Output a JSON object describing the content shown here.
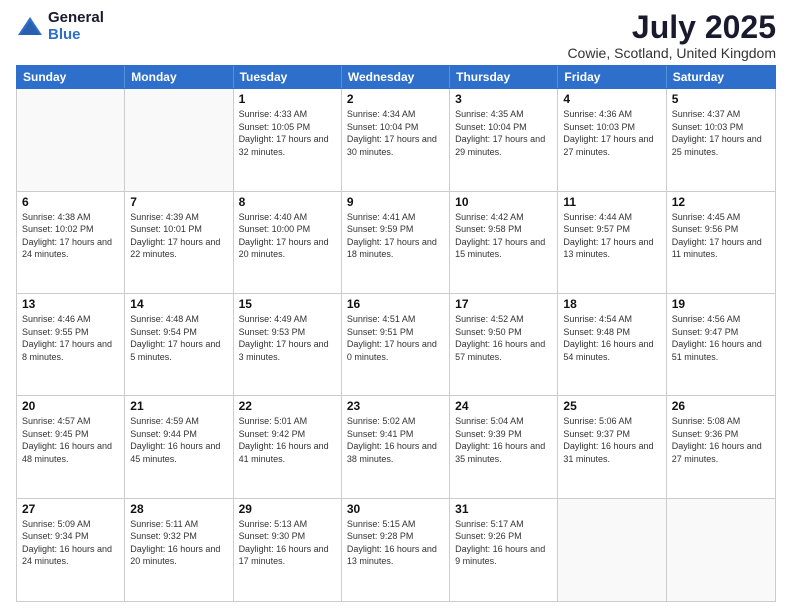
{
  "logo": {
    "general": "General",
    "blue": "Blue"
  },
  "title": "July 2025",
  "subtitle": "Cowie, Scotland, United Kingdom",
  "days_of_week": [
    "Sunday",
    "Monday",
    "Tuesday",
    "Wednesday",
    "Thursday",
    "Friday",
    "Saturday"
  ],
  "weeks": [
    [
      {
        "day": "",
        "empty": true
      },
      {
        "day": "",
        "empty": true
      },
      {
        "day": "1",
        "sunrise": "4:33 AM",
        "sunset": "10:05 PM",
        "daylight": "17 hours and 32 minutes."
      },
      {
        "day": "2",
        "sunrise": "4:34 AM",
        "sunset": "10:04 PM",
        "daylight": "17 hours and 30 minutes."
      },
      {
        "day": "3",
        "sunrise": "4:35 AM",
        "sunset": "10:04 PM",
        "daylight": "17 hours and 29 minutes."
      },
      {
        "day": "4",
        "sunrise": "4:36 AM",
        "sunset": "10:03 PM",
        "daylight": "17 hours and 27 minutes."
      },
      {
        "day": "5",
        "sunrise": "4:37 AM",
        "sunset": "10:03 PM",
        "daylight": "17 hours and 25 minutes."
      }
    ],
    [
      {
        "day": "6",
        "sunrise": "4:38 AM",
        "sunset": "10:02 PM",
        "daylight": "17 hours and 24 minutes."
      },
      {
        "day": "7",
        "sunrise": "4:39 AM",
        "sunset": "10:01 PM",
        "daylight": "17 hours and 22 minutes."
      },
      {
        "day": "8",
        "sunrise": "4:40 AM",
        "sunset": "10:00 PM",
        "daylight": "17 hours and 20 minutes."
      },
      {
        "day": "9",
        "sunrise": "4:41 AM",
        "sunset": "9:59 PM",
        "daylight": "17 hours and 18 minutes."
      },
      {
        "day": "10",
        "sunrise": "4:42 AM",
        "sunset": "9:58 PM",
        "daylight": "17 hours and 15 minutes."
      },
      {
        "day": "11",
        "sunrise": "4:44 AM",
        "sunset": "9:57 PM",
        "daylight": "17 hours and 13 minutes."
      },
      {
        "day": "12",
        "sunrise": "4:45 AM",
        "sunset": "9:56 PM",
        "daylight": "17 hours and 11 minutes."
      }
    ],
    [
      {
        "day": "13",
        "sunrise": "4:46 AM",
        "sunset": "9:55 PM",
        "daylight": "17 hours and 8 minutes."
      },
      {
        "day": "14",
        "sunrise": "4:48 AM",
        "sunset": "9:54 PM",
        "daylight": "17 hours and 5 minutes."
      },
      {
        "day": "15",
        "sunrise": "4:49 AM",
        "sunset": "9:53 PM",
        "daylight": "17 hours and 3 minutes."
      },
      {
        "day": "16",
        "sunrise": "4:51 AM",
        "sunset": "9:51 PM",
        "daylight": "17 hours and 0 minutes."
      },
      {
        "day": "17",
        "sunrise": "4:52 AM",
        "sunset": "9:50 PM",
        "daylight": "16 hours and 57 minutes."
      },
      {
        "day": "18",
        "sunrise": "4:54 AM",
        "sunset": "9:48 PM",
        "daylight": "16 hours and 54 minutes."
      },
      {
        "day": "19",
        "sunrise": "4:56 AM",
        "sunset": "9:47 PM",
        "daylight": "16 hours and 51 minutes."
      }
    ],
    [
      {
        "day": "20",
        "sunrise": "4:57 AM",
        "sunset": "9:45 PM",
        "daylight": "16 hours and 48 minutes."
      },
      {
        "day": "21",
        "sunrise": "4:59 AM",
        "sunset": "9:44 PM",
        "daylight": "16 hours and 45 minutes."
      },
      {
        "day": "22",
        "sunrise": "5:01 AM",
        "sunset": "9:42 PM",
        "daylight": "16 hours and 41 minutes."
      },
      {
        "day": "23",
        "sunrise": "5:02 AM",
        "sunset": "9:41 PM",
        "daylight": "16 hours and 38 minutes."
      },
      {
        "day": "24",
        "sunrise": "5:04 AM",
        "sunset": "9:39 PM",
        "daylight": "16 hours and 35 minutes."
      },
      {
        "day": "25",
        "sunrise": "5:06 AM",
        "sunset": "9:37 PM",
        "daylight": "16 hours and 31 minutes."
      },
      {
        "day": "26",
        "sunrise": "5:08 AM",
        "sunset": "9:36 PM",
        "daylight": "16 hours and 27 minutes."
      }
    ],
    [
      {
        "day": "27",
        "sunrise": "5:09 AM",
        "sunset": "9:34 PM",
        "daylight": "16 hours and 24 minutes."
      },
      {
        "day": "28",
        "sunrise": "5:11 AM",
        "sunset": "9:32 PM",
        "daylight": "16 hours and 20 minutes."
      },
      {
        "day": "29",
        "sunrise": "5:13 AM",
        "sunset": "9:30 PM",
        "daylight": "16 hours and 17 minutes."
      },
      {
        "day": "30",
        "sunrise": "5:15 AM",
        "sunset": "9:28 PM",
        "daylight": "16 hours and 13 minutes."
      },
      {
        "day": "31",
        "sunrise": "5:17 AM",
        "sunset": "9:26 PM",
        "daylight": "16 hours and 9 minutes."
      },
      {
        "day": "",
        "empty": true
      },
      {
        "day": "",
        "empty": true
      }
    ]
  ],
  "labels": {
    "sunrise": "Sunrise:",
    "sunset": "Sunset:",
    "daylight": "Daylight:"
  }
}
